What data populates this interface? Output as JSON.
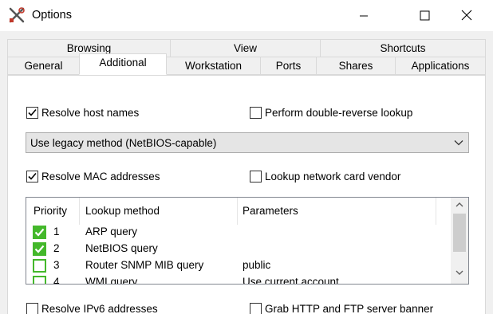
{
  "window": {
    "title": "Options"
  },
  "tabs": {
    "row1": [
      "Browsing",
      "View",
      "Shortcuts"
    ],
    "row2": [
      "General",
      "Additional",
      "Workstation",
      "Ports",
      "Shares",
      "Applications"
    ],
    "active": "Additional"
  },
  "resolve_hosts": {
    "label": "Resolve host names",
    "checked": true
  },
  "double_reverse": {
    "label": "Perform double-reverse lookup",
    "checked": false
  },
  "method_select": {
    "value": "Use legacy method (NetBIOS-capable)"
  },
  "resolve_mac": {
    "label": "Resolve MAC addresses",
    "checked": true
  },
  "nic_vendor": {
    "label": "Lookup network card vendor",
    "checked": false
  },
  "lookup_table": {
    "headers": [
      "Priority",
      "Lookup method",
      "Parameters"
    ],
    "rows": [
      {
        "priority": "1",
        "method": "ARP query",
        "params": "",
        "checked": true
      },
      {
        "priority": "2",
        "method": "NetBIOS query",
        "params": "",
        "checked": true
      },
      {
        "priority": "3",
        "method": "Router SNMP MIB query",
        "params": "public",
        "checked": false
      },
      {
        "priority": "4",
        "method": "WMI query",
        "params": "Use current account",
        "checked": false
      }
    ]
  },
  "resolve_ipv6": {
    "label": "Resolve IPv6 addresses",
    "checked": false
  },
  "grab_banner": {
    "label": "Grab HTTP and FTP server banner",
    "checked": false
  },
  "colors": {
    "accent_green": "#44b82b",
    "panel_bg": "#ffffff",
    "frame_bg": "#f0f0f0"
  }
}
